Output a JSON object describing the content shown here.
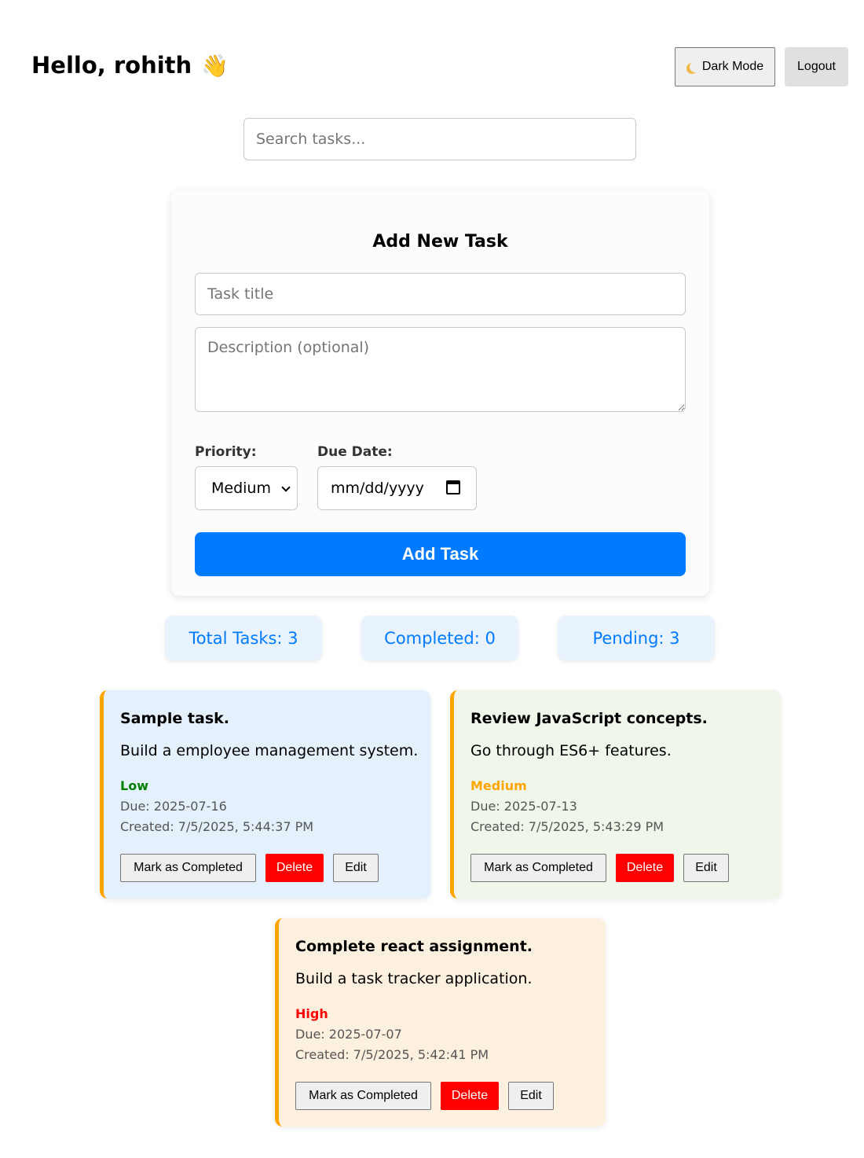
{
  "header": {
    "greeting": "Hello, rohith",
    "greeting_emoji": "👋",
    "dark_mode_label": "Dark Mode",
    "logout_label": "Logout"
  },
  "search": {
    "placeholder": "Search tasks..."
  },
  "form": {
    "title": "Add New Task",
    "title_placeholder": "Task title",
    "description_placeholder": "Description (optional)",
    "priority_label": "Priority:",
    "priority_value": "Medium",
    "due_label": "Due Date:",
    "due_value": "mm/dd/yyyy",
    "submit_label": "Add Task"
  },
  "stats": {
    "total": "Total Tasks: 3",
    "completed": "Completed: 0",
    "pending": "Pending: 3"
  },
  "tasks": [
    {
      "title": "Sample task.",
      "description": "Build a employee management system.",
      "priority": "Low",
      "due": "Due: 2025-07-16",
      "created": "Created: 7/5/2025, 5:44:37 PM",
      "mark_label": "Mark as Completed",
      "delete_label": "Delete",
      "edit_label": "Edit"
    },
    {
      "title": "Review JavaScript concepts.",
      "description": "Go through ES6+ features.",
      "priority": "Medium",
      "due": "Due: 2025-07-13",
      "created": "Created: 7/5/2025, 5:43:29 PM",
      "mark_label": "Mark as Completed",
      "delete_label": "Delete",
      "edit_label": "Edit"
    },
    {
      "title": "Complete react assignment.",
      "description": "Build a task tracker application.",
      "priority": "High",
      "due": "Due: 2025-07-07",
      "created": "Created: 7/5/2025, 5:42:41 PM",
      "mark_label": "Mark as Completed",
      "delete_label": "Delete",
      "edit_label": "Edit"
    }
  ],
  "colors": {
    "accent": "#007bff",
    "delete": "#ff0000",
    "priority_low": "#008000",
    "priority_medium": "#ffa500",
    "priority_high": "#ff0000",
    "task_border": "#ffa500"
  },
  "icons": {
    "wave": "waving-hand-icon",
    "moon": "moon-icon",
    "chevron": "chevron-down-icon",
    "calendar": "calendar-icon"
  }
}
